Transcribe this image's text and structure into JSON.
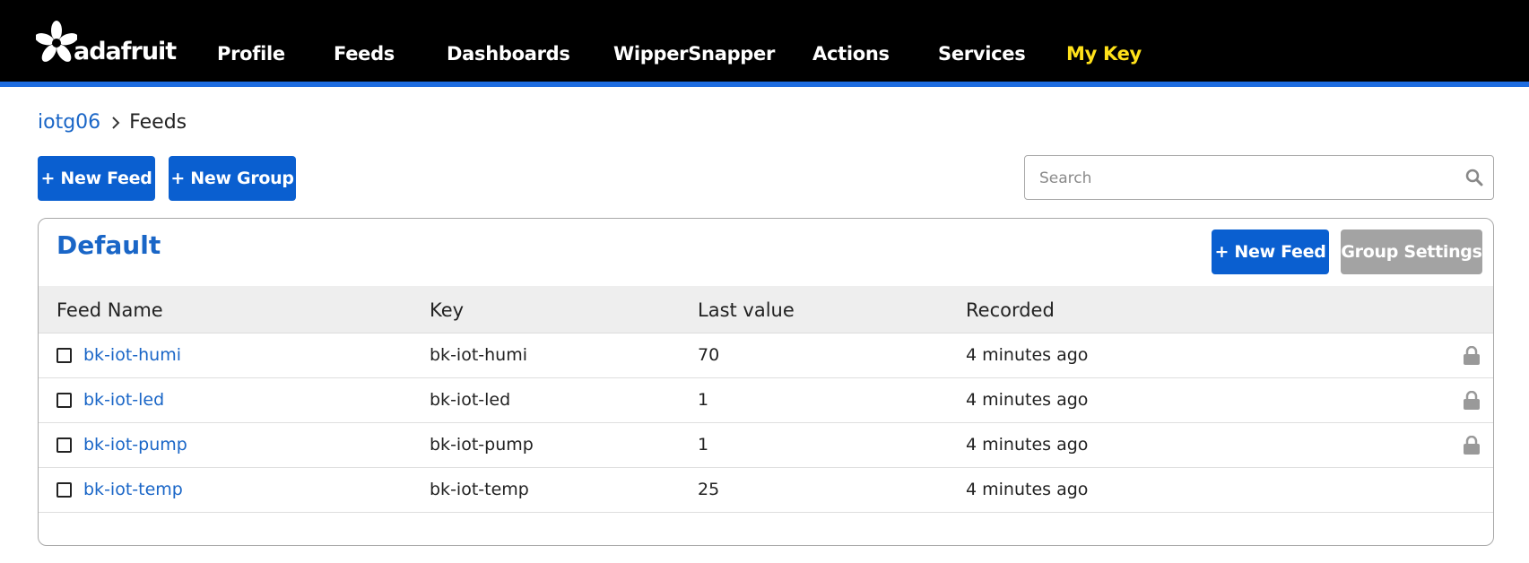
{
  "nav": {
    "logo_text": "adafruit",
    "links": [
      "Profile",
      "Feeds",
      "Dashboards",
      "WipperSnapper",
      "Actions",
      "Services",
      "My Key"
    ]
  },
  "breadcrumb": {
    "user": "iotg06",
    "current": "Feeds"
  },
  "toolbar": {
    "new_feed_label": "+ New Feed",
    "new_group_label": "+ New Group"
  },
  "search": {
    "placeholder": "Search",
    "value": ""
  },
  "group": {
    "title": "Default",
    "new_feed_label": "+ New Feed",
    "settings_label": "Group Settings",
    "columns": [
      "Feed Name",
      "Key",
      "Last value",
      "Recorded"
    ],
    "rows": [
      {
        "name": "bk-iot-humi",
        "key": "bk-iot-humi",
        "last_value": "70",
        "recorded": "4 minutes ago",
        "locked": true
      },
      {
        "name": "bk-iot-led",
        "key": "bk-iot-led",
        "last_value": "1",
        "recorded": "4 minutes ago",
        "locked": true
      },
      {
        "name": "bk-iot-pump",
        "key": "bk-iot-pump",
        "last_value": "1",
        "recorded": "4 minutes ago",
        "locked": true
      },
      {
        "name": "bk-iot-temp",
        "key": "bk-iot-temp",
        "last_value": "25",
        "recorded": "4 minutes ago",
        "locked": false
      }
    ]
  },
  "colors": {
    "nav_background": "#000000",
    "nav_accent": "#1d6ce0",
    "highlight": "#ffe11a",
    "primary": "#0a5fd0",
    "link": "#1a66c7",
    "secondary": "#a3a3a3"
  },
  "icons": [
    "adafruit-logo-icon",
    "chevron-right-icon",
    "search-icon",
    "checkbox-icon",
    "lock-icon"
  ]
}
